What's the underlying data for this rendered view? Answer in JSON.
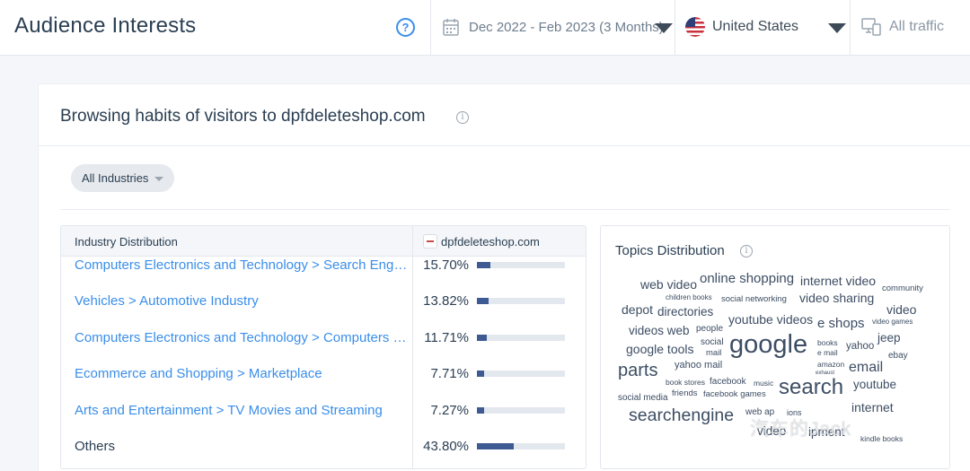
{
  "header": {
    "title": "Audience Interests",
    "date_range": "Dec 2022 - Feb 2023 (3 Months)",
    "country": "United States",
    "traffic": "All traffic"
  },
  "card": {
    "title": "Browsing habits of visitors to dpfdeleteshop.com",
    "industry_filter": "All Industries"
  },
  "table": {
    "col_industry": "Industry Distribution",
    "col_site": "dpfdeleteshop.com",
    "rows": [
      {
        "label": "Computers Electronics and Technology > Search Engines",
        "pct": "15.70%",
        "share": 0.157,
        "link": true
      },
      {
        "label": "Vehicles > Automotive Industry",
        "pct": "13.82%",
        "share": 0.1382,
        "link": true
      },
      {
        "label": "Computers Electronics and Technology > Computers Electronics and Technology",
        "pct": "11.71%",
        "share": 0.1171,
        "link": true
      },
      {
        "label": "Ecommerce and Shopping > Marketplace",
        "pct": "7.71%",
        "share": 0.0771,
        "link": true
      },
      {
        "label": "Arts and Entertainment > TV Movies and Streaming",
        "pct": "7.27%",
        "share": 0.0727,
        "link": true
      },
      {
        "label": "Others",
        "pct": "43.80%",
        "share": 0.438,
        "link": false
      }
    ]
  },
  "topics": {
    "title": "Topics Distribution",
    "words": [
      "web video",
      "online shopping",
      "internet video",
      "children books",
      "social networking",
      "video sharing",
      "community",
      "depot",
      "directories",
      "video",
      "youtube videos",
      "e shops",
      "video games",
      "videos web",
      "people",
      "google tools",
      "social",
      "google",
      "books",
      "yahoo",
      "jeep",
      "mail",
      "e mail",
      "ebay",
      "parts",
      "yahoo mail",
      "amazon",
      "email",
      "exhaust",
      "book stores",
      "facebook",
      "music",
      "search",
      "youtube",
      "friends",
      "facebook games",
      "social media",
      "internet",
      "searchengine",
      "web ap",
      "ions",
      "video",
      "ipment",
      "kindle books"
    ]
  },
  "watermark": "汽车的Jack"
}
